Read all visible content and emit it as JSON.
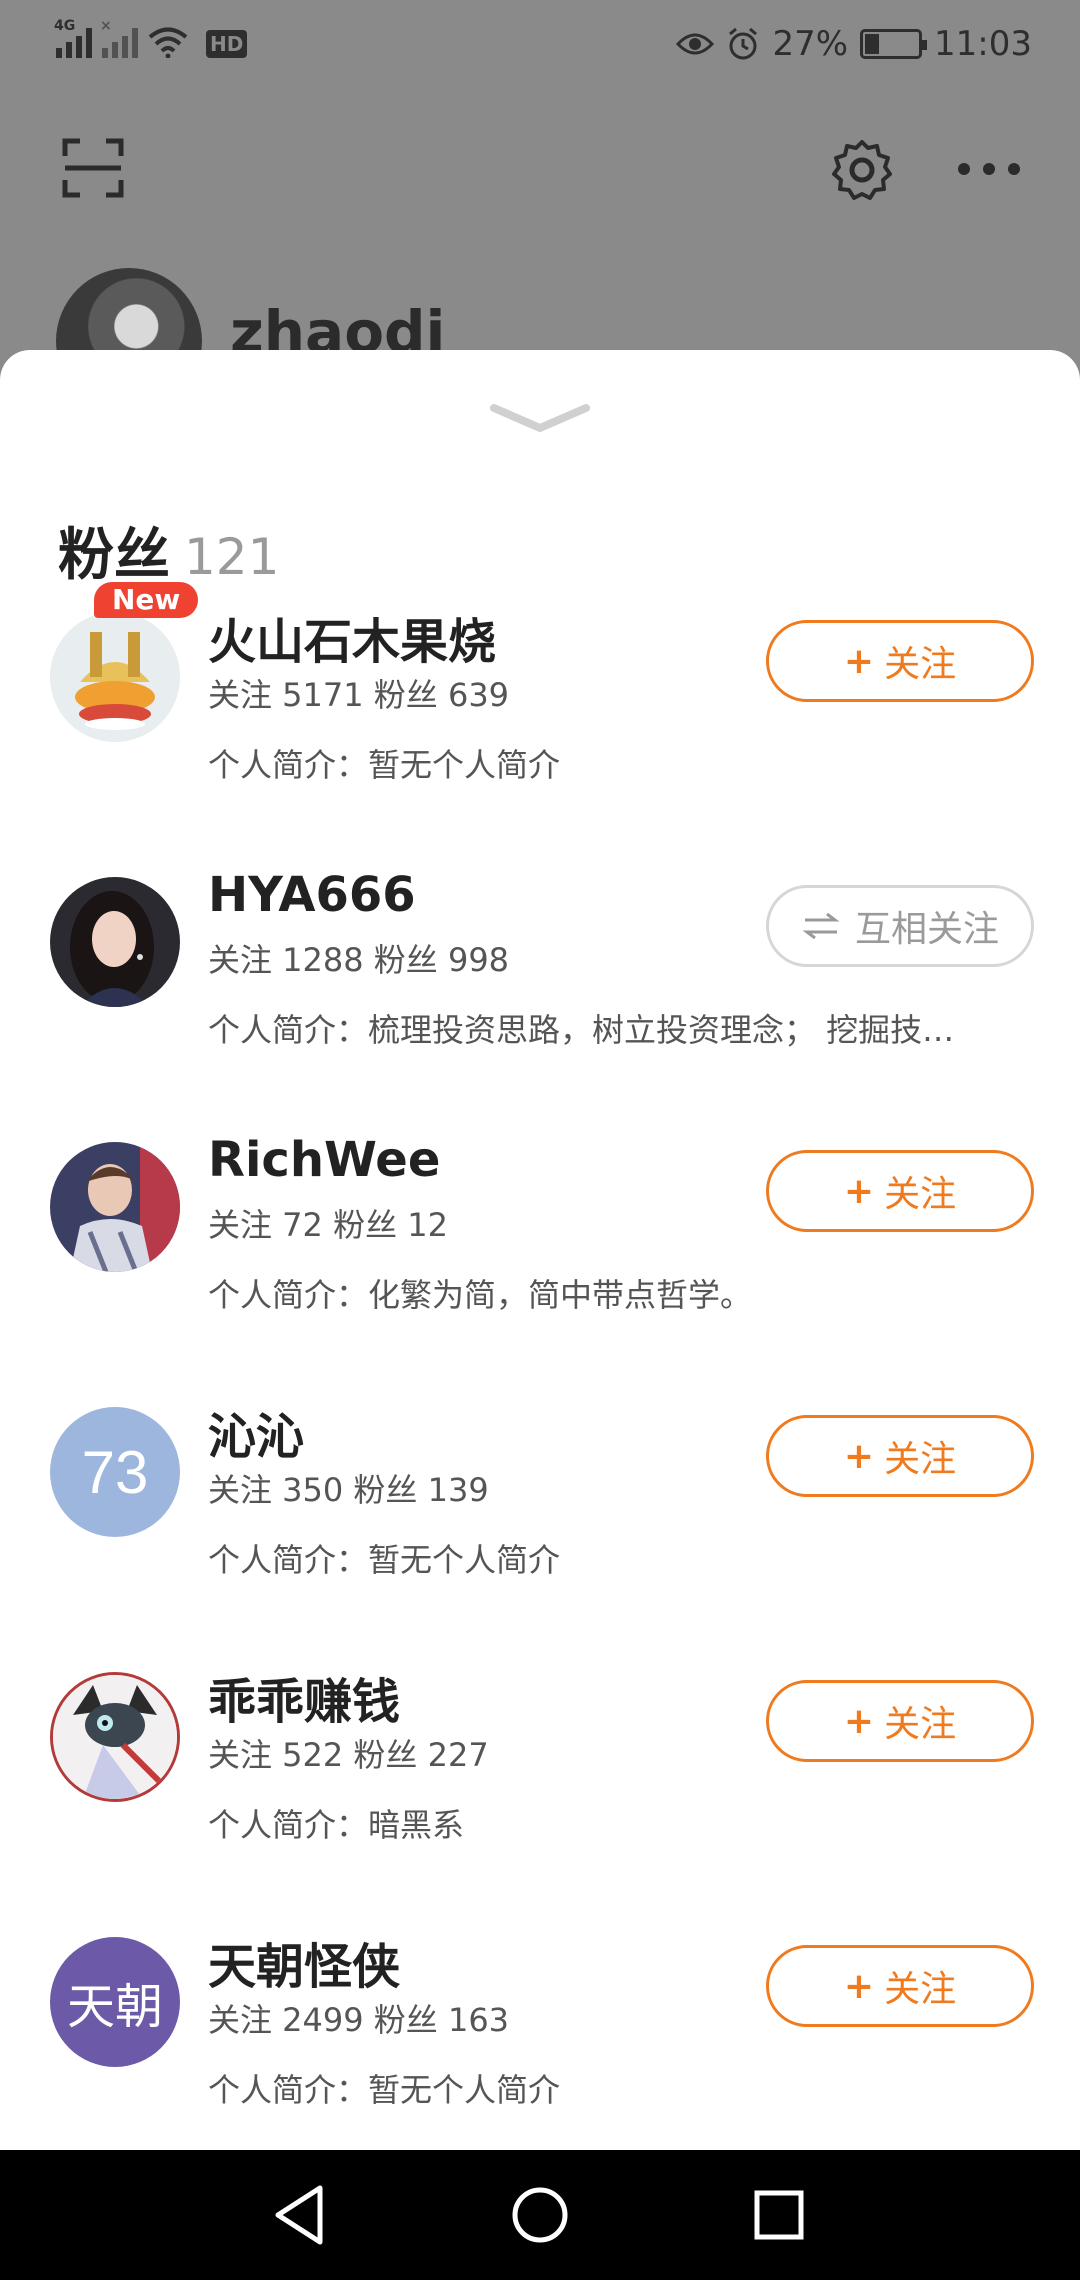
{
  "status_bar": {
    "network": "4G",
    "network2": "×",
    "hd": "HD",
    "battery_percent": "27%",
    "time": "11:03"
  },
  "profile_bg": {
    "username": "zhaodi"
  },
  "sheet": {
    "title": "粉丝",
    "count": "121"
  },
  "fans": [
    {
      "name": "火山石木果烧",
      "stats": "关注 5171 粉丝 639",
      "bio": "个人简介：暂无个人简介",
      "badge": "New",
      "action": "follow",
      "action_label": "关注",
      "avatar_icon": "rice-bowl-avatar"
    },
    {
      "name": "HYA666",
      "stats": "关注 1288 粉丝 998",
      "bio": "个人简介：梳理投资思路，树立投资理念； 挖掘技…",
      "action": "mutual",
      "action_label": "互相关注",
      "avatar_icon": "woman-photo-avatar"
    },
    {
      "name": "RichWee",
      "stats": "关注 72 粉丝 12",
      "bio": "个人简介：化繁为简，简中带点哲学。",
      "action": "follow",
      "action_label": "关注",
      "avatar_icon": "singer-photo-avatar"
    },
    {
      "name": "沁沁",
      "stats": "关注 350 粉丝 139",
      "bio": "个人简介：暂无个人简介",
      "action": "follow",
      "action_label": "关注",
      "avatar_text": "73",
      "avatar_color": "#9db6dd"
    },
    {
      "name": "乖乖赚钱",
      "stats": "关注 522 粉丝 227",
      "bio": "个人简介：暗黑系",
      "action": "follow",
      "action_label": "关注",
      "avatar_icon": "anime-drawing-avatar"
    },
    {
      "name": "天朝怪侠",
      "stats": "关注 2499 粉丝 163",
      "bio": "个人简介：暂无个人简介",
      "action": "follow",
      "action_label": "关注",
      "avatar_text": "天朝",
      "avatar_color": "#6c5aa8"
    }
  ],
  "colors": {
    "accent": "#f07a1e",
    "badge": "#ef4230",
    "mutual_border": "#d6d6d6"
  },
  "icons": {
    "scan": "scan-icon",
    "settings": "gear-icon",
    "more": "more-icon",
    "collapse": "chevron-down-icon",
    "nav_back": "back-triangle-icon",
    "nav_home": "home-circle-icon",
    "nav_recents": "recents-square-icon"
  }
}
